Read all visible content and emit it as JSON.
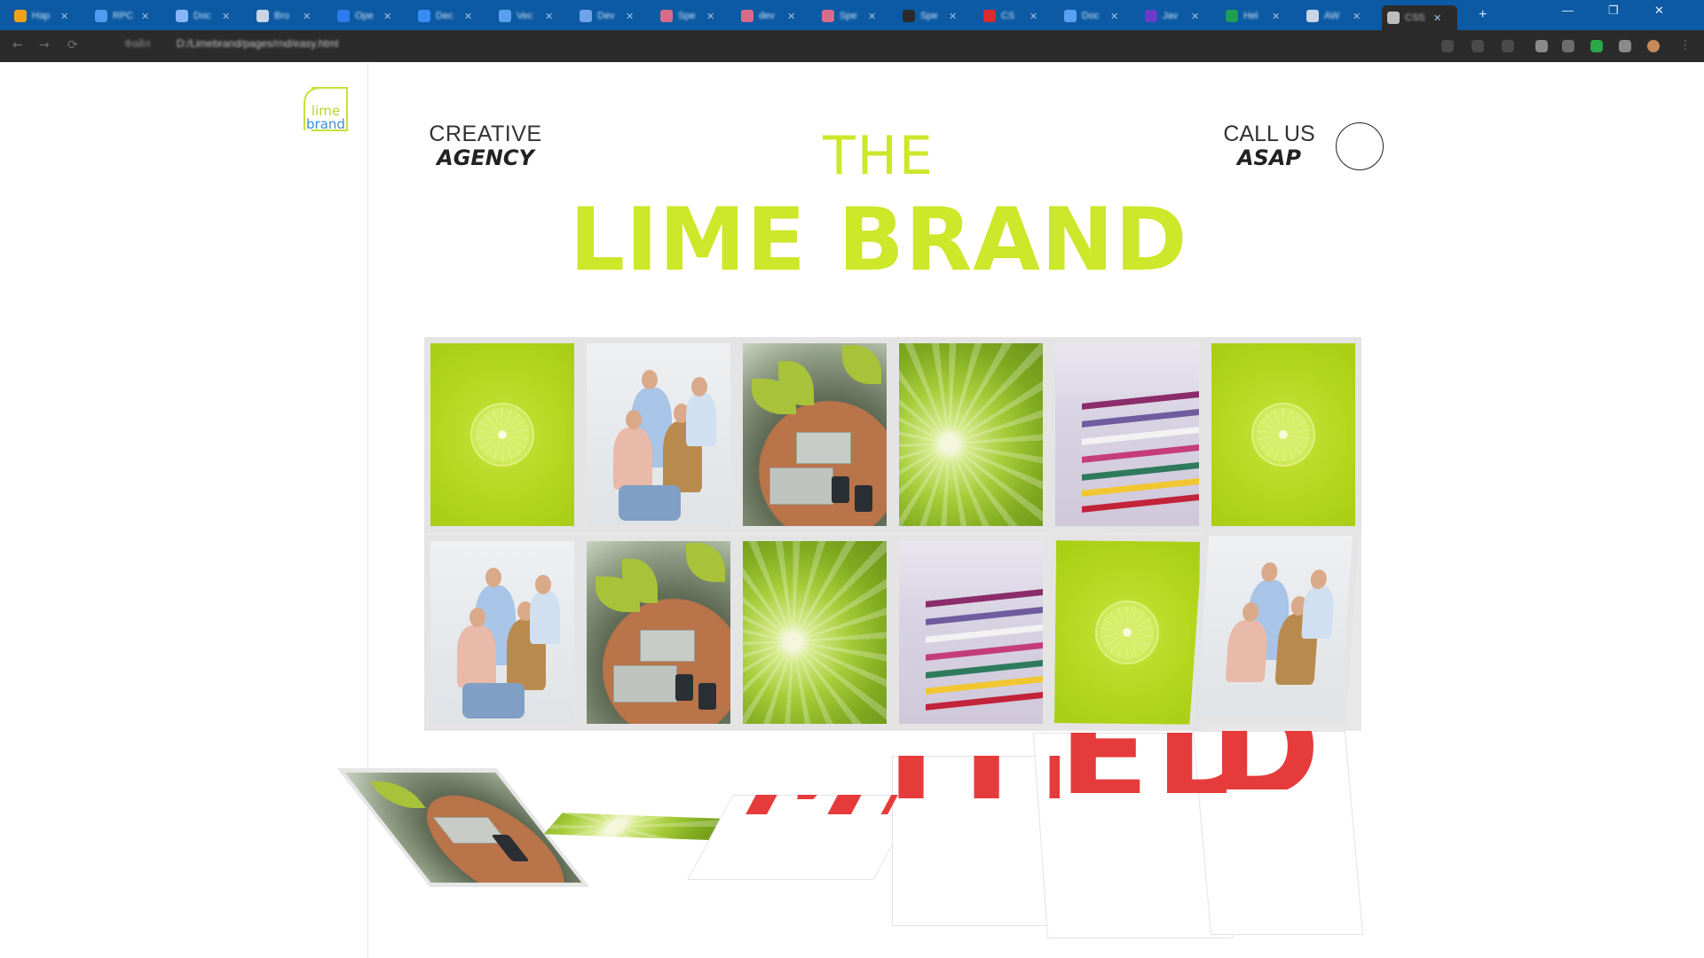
{
  "browser": {
    "tabs": [
      {
        "title": "Hap",
        "favicon_color": "#f0a11b"
      },
      {
        "title": "RPC",
        "favicon_color": "#4f9bf0"
      },
      {
        "title": "Doc",
        "favicon_color": "#8ab4f8"
      },
      {
        "title": "Bro",
        "favicon_color": "#c9d4e4"
      },
      {
        "title": "Ope",
        "favicon_color": "#2f7bf0"
      },
      {
        "title": "Dec",
        "favicon_color": "#3a8cf5"
      },
      {
        "title": "Vec",
        "favicon_color": "#5aa0f2"
      },
      {
        "title": "Dev",
        "favicon_color": "#6fa3e8"
      },
      {
        "title": "Spe",
        "favicon_color": "#d86a8a"
      },
      {
        "title": "dev",
        "favicon_color": "#d86a8a"
      },
      {
        "title": "Spe",
        "favicon_color": "#d86a8a"
      },
      {
        "title": "Spe",
        "favicon_color": "#2b2b2b"
      },
      {
        "title": "CS",
        "favicon_color": "#e0292f"
      },
      {
        "title": "Doc",
        "favicon_color": "#5aa0f2"
      },
      {
        "title": "Jav",
        "favicon_color": "#6a3cc7"
      },
      {
        "title": "Hel",
        "favicon_color": "#1f9d55"
      },
      {
        "title": "AW",
        "favicon_color": "#c9d4e4"
      },
      {
        "title": "CSS",
        "favicon_color": "#bdbdbd"
      }
    ],
    "new_tab": "+",
    "window_controls": [
      "⌄",
      "—",
      "❐",
      "✕"
    ],
    "nav": {
      "back": "←",
      "forward": "→",
      "reload": "⟳"
    },
    "url_prefix": "Файл",
    "url": "D:/Limebrand/pages/rnd/easy.html"
  },
  "page": {
    "logo": {
      "line1": "lime",
      "line2": "brand"
    },
    "creative": {
      "line1": "CREATIVE",
      "line2": "AGENCY"
    },
    "call": {
      "line1": "CALL US",
      "line2": "ASAP"
    },
    "title_small": "THE",
    "title_big": "LIME BRAND",
    "red_word": "LIMITED"
  },
  "colors": {
    "accent_lime": "#cde72a",
    "tab_bar_blue": "#0b5aa3",
    "address_bar_dark": "#2b2b2b",
    "red_text": "#e63b3b"
  }
}
